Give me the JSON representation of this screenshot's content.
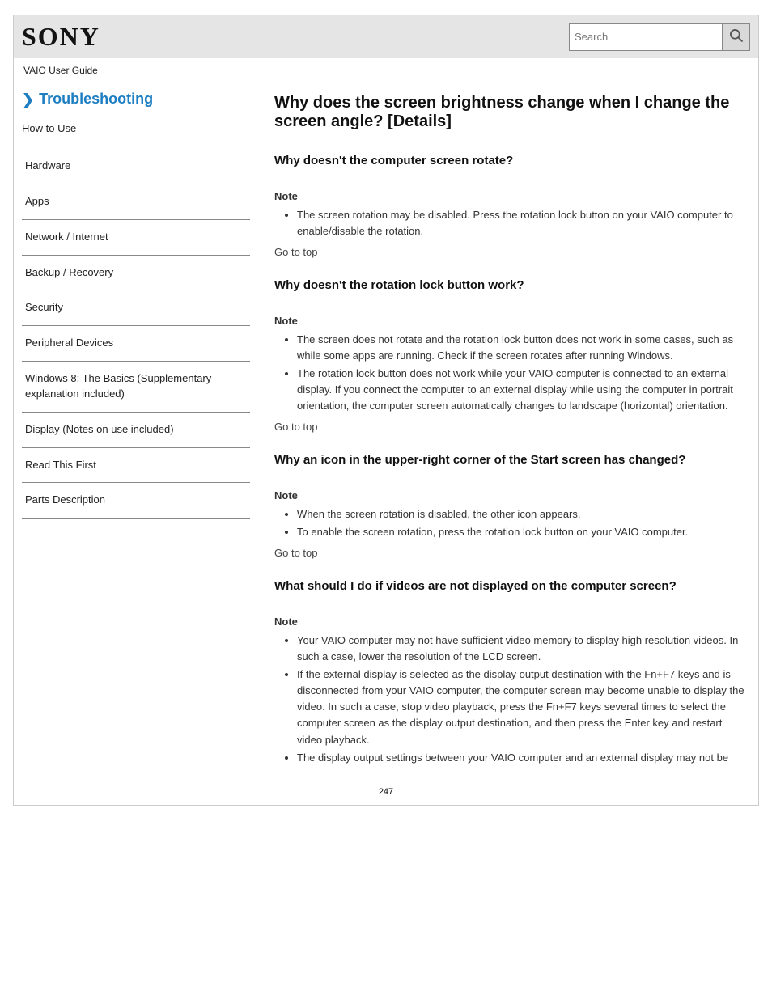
{
  "header": {
    "logo_text": "SONY",
    "search_placeholder": "Search"
  },
  "product_line": "VAIO User Guide",
  "sidebar": {
    "section_label": "Troubleshooting",
    "how_to_label": "How to Use",
    "items": [
      "Hardware",
      "Apps",
      "Network / Internet",
      "Backup / Recovery",
      "Security",
      "Peripheral Devices",
      "Windows 8: The Basics (Supplementary explanation included)",
      "Display (Notes on use included)",
      "Read This First",
      "Parts Description"
    ]
  },
  "main": {
    "title": "Why does the screen brightness change when I change the screen angle? [Details]",
    "items": [
      {
        "heading": "Why doesn't the computer screen rotate?",
        "notes": [
          "The screen rotation may be disabled. Press the rotation lock button on your VAIO computer to enable/disable the rotation."
        ],
        "goto": "Go to top"
      },
      {
        "heading": "Why doesn't the rotation lock button work?",
        "notes": [
          "The screen does not rotate and the rotation lock button does not work in some cases, such as while some apps are running. Check if the screen rotates after running Windows.",
          "The rotation lock button does not work while your VAIO computer is connected to an external display. If you connect the computer to an external display while using the computer in portrait orientation, the computer screen automatically changes to landscape (horizontal) orientation."
        ],
        "goto": "Go to top"
      },
      {
        "heading": "Why an icon in the upper-right corner of the Start screen has changed?",
        "notes": [
          "When the screen rotation is disabled, the other icon appears.",
          "To enable the screen rotation, press the rotation lock button on your VAIO computer."
        ],
        "goto": "Go to top"
      },
      {
        "heading": "What should I do if videos are not displayed on the computer screen?",
        "notes": [
          "Your VAIO computer may not have sufficient video memory to display high resolution videos. In such a case, lower the resolution of the LCD screen.",
          "If the external display is selected as the display output destination with the Fn+F7 keys and is disconnected from your VAIO computer, the computer screen may become unable to display the video. In such a case, stop video playback, press the Fn+F7 keys several times to select the computer screen as the display output destination, and then press the Enter key and restart video playback.",
          "The display output settings between your VAIO computer and an external display may not be"
        ],
        "goto": ""
      }
    ]
  },
  "page_number": "247"
}
